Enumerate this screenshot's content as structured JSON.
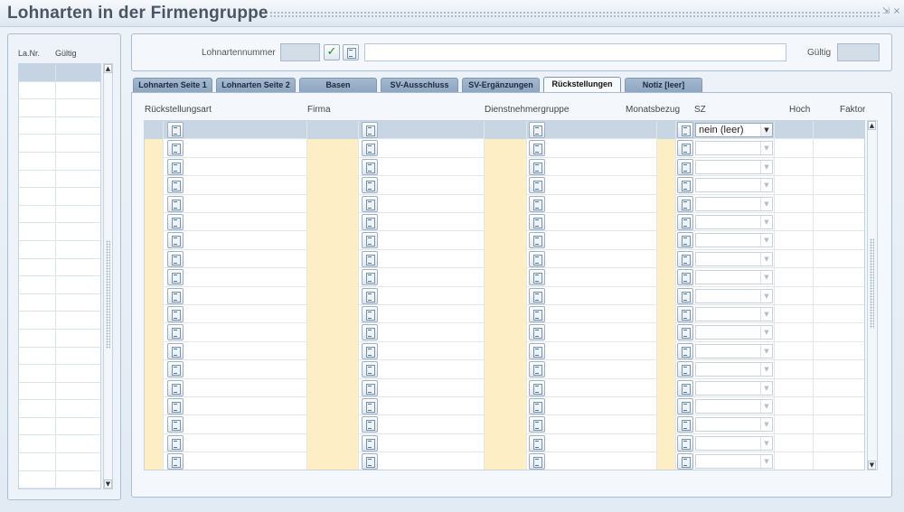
{
  "window": {
    "title": "Lohnarten in der Firmengruppe"
  },
  "left_panel": {
    "columns": [
      "La.Nr.",
      "Gültig"
    ],
    "row_count": 24
  },
  "header": {
    "lohnartennummer_label": "Lohnartennummer",
    "lohnartennummer_value": "",
    "description_value": "",
    "gueltig_label": "Gültig",
    "gueltig_value": ""
  },
  "tabs": [
    {
      "label": "Lohnarten Seite 1",
      "active": false
    },
    {
      "label": "Lohnarten Seite 2",
      "active": false
    },
    {
      "label": "Basen",
      "active": false
    },
    {
      "label": "SV-Ausschluss",
      "active": false
    },
    {
      "label": "SV-Ergänzungen",
      "active": false
    },
    {
      "label": "Rückstellungen",
      "active": true
    },
    {
      "label": "Notiz [leer]",
      "active": false
    }
  ],
  "grid": {
    "columns": {
      "rueckstellungsart": "Rückstellungsart",
      "firma": "Firma",
      "dienstnehmergruppe": "Dienstnehmergruppe",
      "monatsbezug": "Monatsbezug",
      "sz": "SZ",
      "hoch": "Hoch",
      "faktor": "Faktor"
    },
    "first_row_sz": "nein (leer)",
    "row_count": 19
  }
}
